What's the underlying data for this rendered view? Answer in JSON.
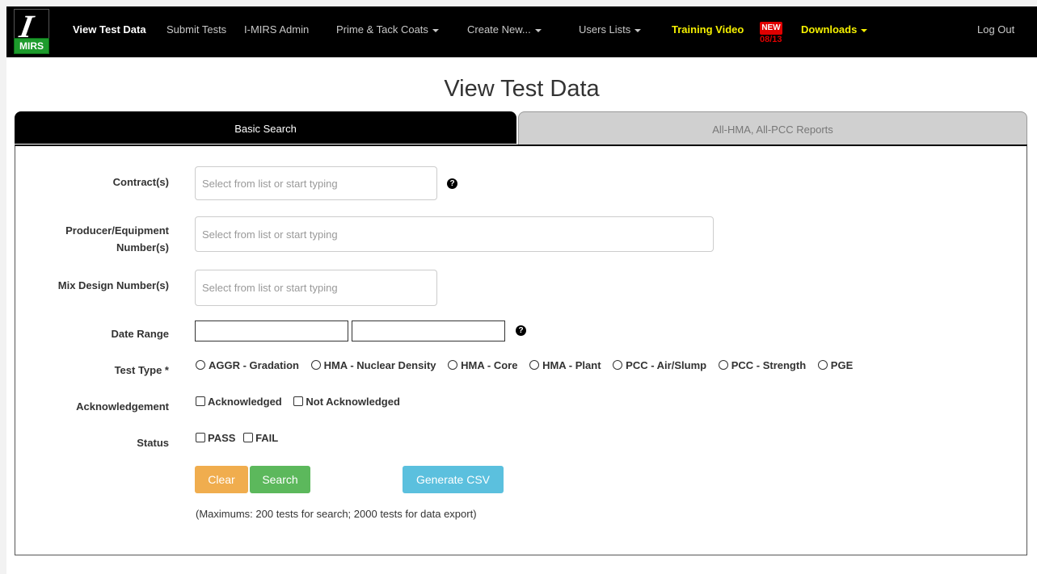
{
  "navbar": {
    "logo_letter": "I",
    "logo_text": "MIRS",
    "items": [
      {
        "label": "View Test Data"
      },
      {
        "label": "Submit Tests"
      },
      {
        "label": "I-MIRS Admin"
      },
      {
        "label": "Prime & Tack Coats"
      },
      {
        "label": "Create New..."
      },
      {
        "label": "Users Lists"
      },
      {
        "label": "Training Video"
      },
      {
        "label": "Downloads"
      },
      {
        "label": "Log Out"
      }
    ],
    "new_badge": "NEW",
    "new_date": "08/13"
  },
  "page_title": "View Test Data",
  "tabs": [
    {
      "label": "Basic Search"
    },
    {
      "label": "All-HMA, All-PCC Reports"
    }
  ],
  "form": {
    "contracts_label": "Contract(s)",
    "contracts_placeholder": "Select from list or start typing",
    "producer_label_1": "Producer/Equipment",
    "producer_label_2": "Number(s)",
    "producer_placeholder": "Select from list or start typing",
    "mix_label": "Mix Design Number(s)",
    "mix_placeholder": "Select from list or start typing",
    "date_label": "Date Range",
    "test_type_label": "Test Type *",
    "test_types": [
      "AGGR - Gradation",
      "HMA - Nuclear Density",
      "HMA - Core",
      "HMA - Plant",
      "PCC - Air/Slump",
      "PCC - Strength",
      "PGE"
    ],
    "ack_label": "Acknowledgement",
    "ack_options": [
      "Acknowledged",
      "Not Acknowledged"
    ],
    "status_label": "Status",
    "status_options": [
      "PASS",
      "FAIL"
    ],
    "help_glyph": "?"
  },
  "buttons": {
    "clear": "Clear",
    "search": "Search",
    "csv": "Generate CSV"
  },
  "note": "(Maximums: 200 tests for search; 2000 tests for data export)",
  "colors": {
    "navbar_bg": "#000000",
    "nav_yellow": "#f5f000",
    "new_red": "#e00000",
    "clear_btn": "#f0ad4e",
    "search_btn": "#5cb85c",
    "csv_btn": "#5bc0de"
  }
}
